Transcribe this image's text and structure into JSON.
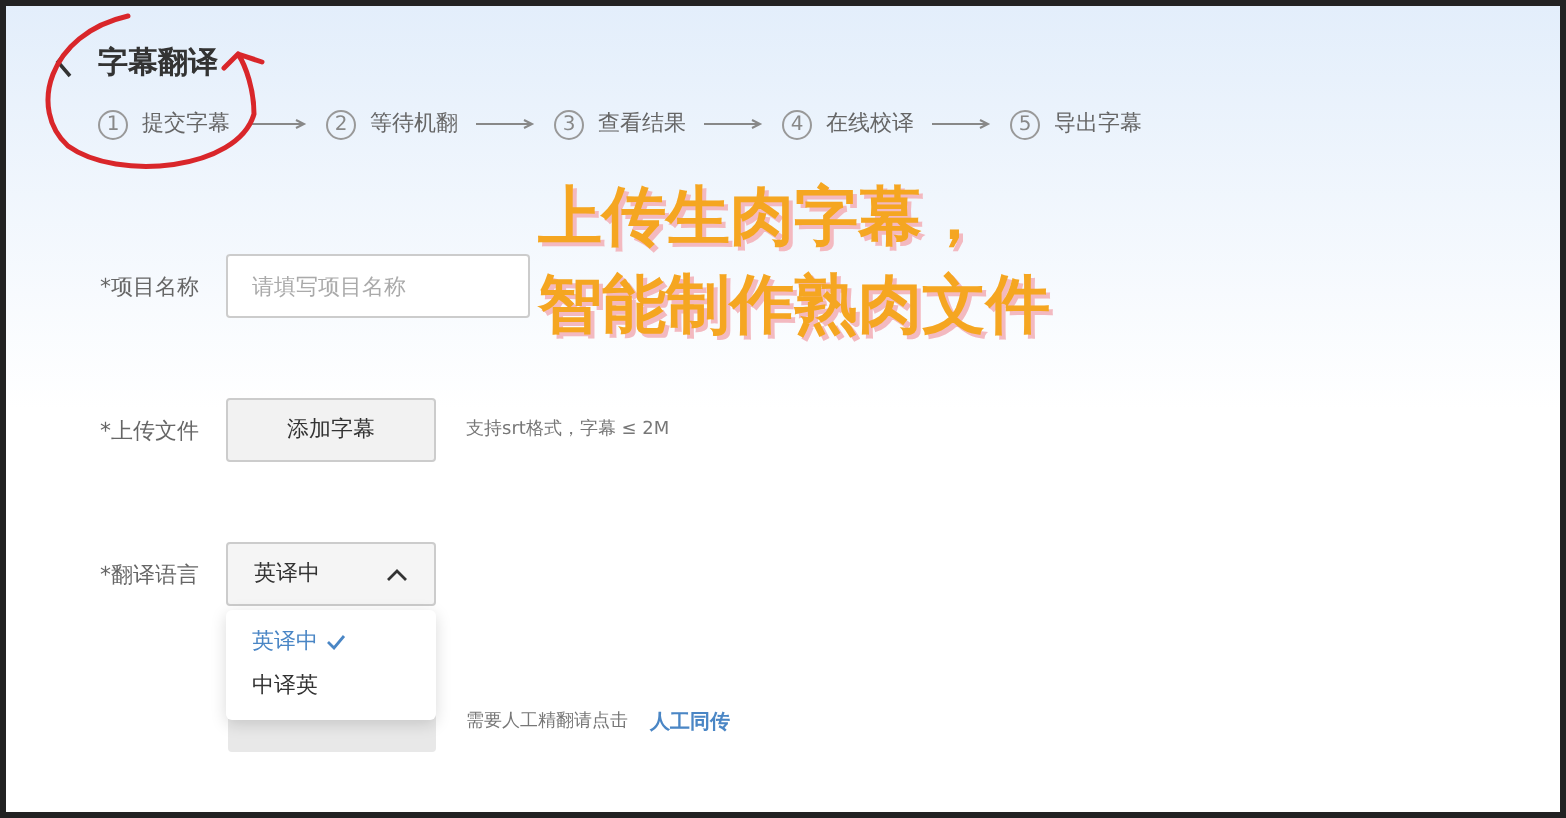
{
  "header": {
    "title": "字幕翻译"
  },
  "steps": [
    {
      "number": "1",
      "label": "提交字幕"
    },
    {
      "number": "2",
      "label": "等待机翻"
    },
    {
      "number": "3",
      "label": "查看结果"
    },
    {
      "number": "4",
      "label": "在线校译"
    },
    {
      "number": "5",
      "label": "导出字幕"
    }
  ],
  "form": {
    "name_field": {
      "label": "*项目名称",
      "placeholder": "请填写项目名称"
    },
    "upload": {
      "label": "*上传文件",
      "button": "添加字幕",
      "hint": "支持srt格式，字幕 ≤ 2M"
    },
    "language": {
      "label": "*翻译语言",
      "value": "英译中",
      "expanded": true,
      "options": [
        {
          "label": "英译中",
          "selected": true
        },
        {
          "label": "中译英",
          "selected": false
        }
      ]
    },
    "submit_hint": {
      "text": "需要人工精翻请点击",
      "link": "人工同传"
    }
  },
  "caption": [
    "上传生肉字幕，",
    "智能制作熟肉文件"
  ]
}
